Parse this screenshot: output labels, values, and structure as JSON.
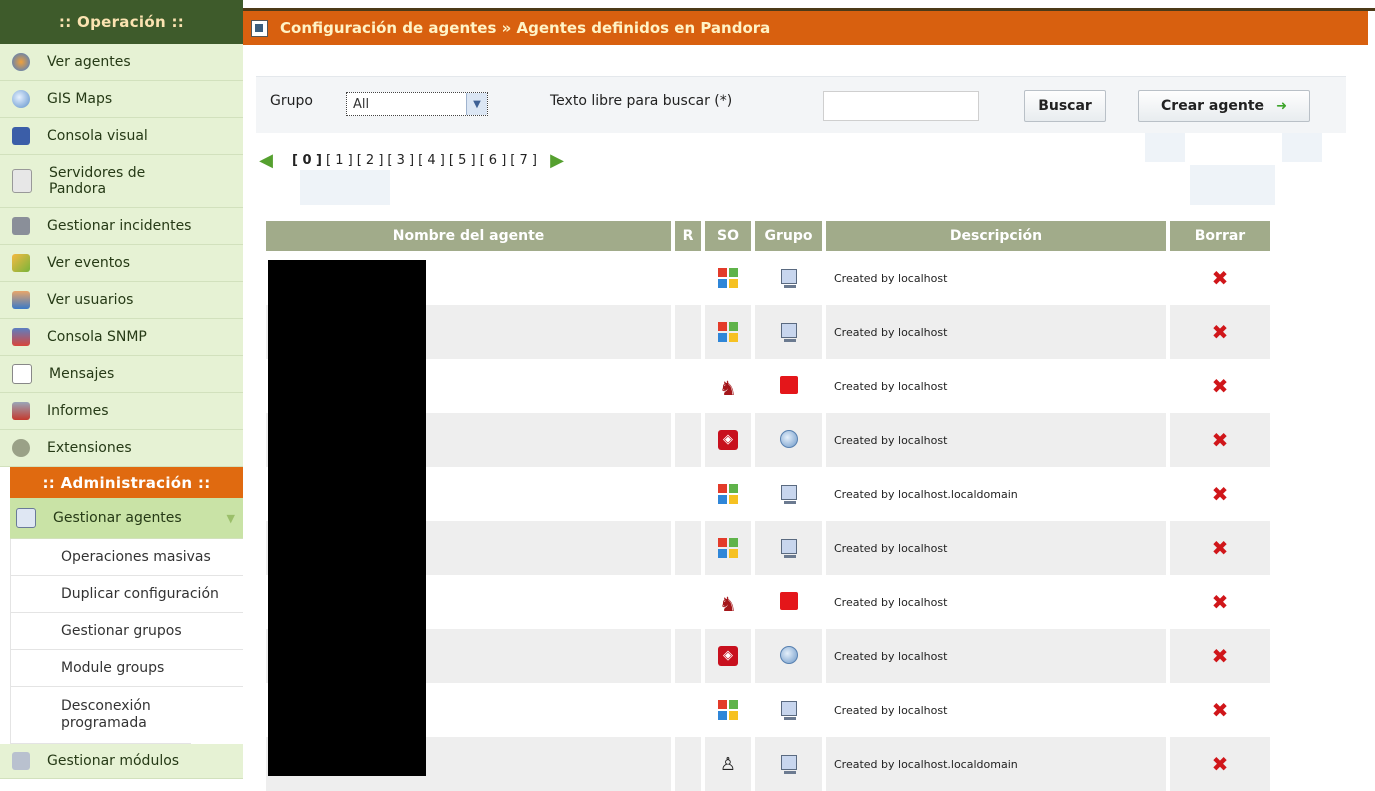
{
  "sidebar": {
    "operation_header": ":: Operación ::",
    "operation_items": [
      {
        "label": "Ver agentes",
        "icon": "agents-icon"
      },
      {
        "label": "GIS Maps",
        "icon": "globe-icon"
      },
      {
        "label": "Consola visual",
        "icon": "monitor-icon"
      },
      {
        "label": "Servidores de Pandora",
        "icon": "server-icon"
      },
      {
        "label": "Gestionar incidentes",
        "icon": "incident-icon"
      },
      {
        "label": "Ver eventos",
        "icon": "events-icon"
      },
      {
        "label": "Ver usuarios",
        "icon": "users-icon"
      },
      {
        "label": "Consola SNMP",
        "icon": "snmp-icon"
      },
      {
        "label": "Mensajes",
        "icon": "envelope-icon"
      },
      {
        "label": "Informes",
        "icon": "reports-icon"
      },
      {
        "label": "Extensiones",
        "icon": "gears-icon"
      }
    ],
    "admin_header": ":: Administración ::",
    "admin_active": {
      "label": "Gestionar agentes",
      "icon": "agent-manage-icon"
    },
    "admin_subitems": [
      "Operaciones masivas",
      "Duplicar configuración",
      "Gestionar grupos",
      "Module groups",
      "Desconexión programada"
    ],
    "admin_last": {
      "label": "Gestionar módulos",
      "icon": "modules-icon"
    }
  },
  "header": {
    "title": "Configuración de agentes » Agentes definidos en Pandora"
  },
  "filters": {
    "group_label": "Grupo",
    "group_value": "All",
    "search_label": "Texto libre para buscar (*)",
    "search_value": "",
    "search_button": "Buscar",
    "create_button": "Crear agente"
  },
  "pagination": {
    "pages": [
      "0",
      "1",
      "2",
      "3",
      "4",
      "5",
      "6",
      "7"
    ],
    "current": "0"
  },
  "table": {
    "columns": [
      "Nombre del agente",
      "R",
      "SO",
      "Grupo",
      "Descripción",
      "Borrar"
    ],
    "rows": [
      {
        "os": "windows",
        "group": "monitor",
        "description": "Created by localhost"
      },
      {
        "os": "windows",
        "group": "monitor",
        "description": "Created by localhost"
      },
      {
        "os": "bsd",
        "group": "firewall",
        "description": "Created by localhost"
      },
      {
        "os": "solaris",
        "group": "globe",
        "description": "Created by localhost"
      },
      {
        "os": "windows",
        "group": "monitor",
        "description": "Created by localhost.localdomain"
      },
      {
        "os": "windows",
        "group": "monitor",
        "description": "Created by localhost"
      },
      {
        "os": "bsd",
        "group": "firewall",
        "description": "Created by localhost"
      },
      {
        "os": "solaris",
        "group": "globe",
        "description": "Created by localhost"
      },
      {
        "os": "windows",
        "group": "monitor",
        "description": "Created by localhost"
      },
      {
        "os": "linux",
        "group": "monitor",
        "description": "Created by localhost.localdomain"
      }
    ],
    "delete_symbol": "✖"
  },
  "colors": {
    "operation_header_bg": "#3e5b2b",
    "admin_header_bg": "#e06a10",
    "title_bar_bg": "#d8600f",
    "table_header_bg": "#a1ab8a",
    "delete_red": "#d0161a"
  }
}
